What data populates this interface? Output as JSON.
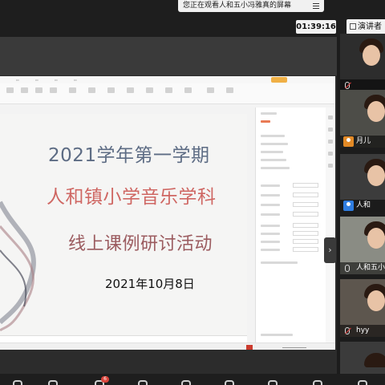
{
  "banner": {
    "text": "您正在观看人和五小冯雅真的屏幕"
  },
  "timer": "01:39:16",
  "speaker_tab": "演讲者",
  "slide": {
    "title": "2021学年第一学期",
    "subtitle": "人和镇小学音乐学科",
    "activity": "线上课例研讨活动",
    "date": "2021年10月8日"
  },
  "participants": [
    {
      "name": "",
      "mic": "muted"
    },
    {
      "name": "月儿",
      "mic": "on"
    },
    {
      "name": "人和",
      "mic": "muted"
    },
    {
      "name": "人和五小",
      "mic": "on"
    },
    {
      "name": "hyy",
      "mic": "muted"
    },
    {
      "name": "",
      "mic": "none"
    }
  ],
  "toolbar": {
    "badge_count": "6"
  },
  "colors": {
    "active_border": "#3aa84a",
    "title_blue": "#5d6c84",
    "title_red": "#cf6763",
    "badge_red": "#d9433a"
  }
}
